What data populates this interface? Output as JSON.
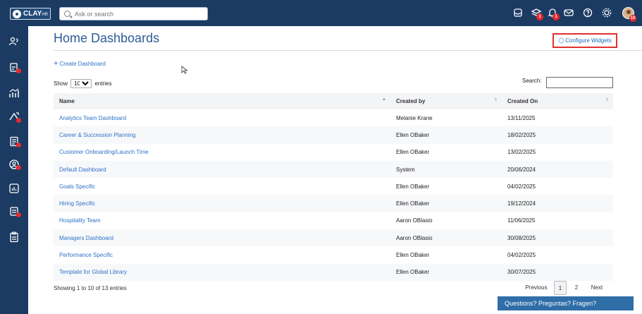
{
  "brand": {
    "logo_main": "CLAY",
    "logo_sub": "HR"
  },
  "topbar": {
    "search_placeholder": "Ask or search",
    "badges": [
      "1",
      "1",
      "10"
    ]
  },
  "page": {
    "title": "Home Dashboards",
    "configure_label": "Configure Widgets",
    "create_label": "Create Dashboard",
    "show_label": "Show",
    "entries_label": "entries",
    "entries_value": "10",
    "search_label": "Search:"
  },
  "table": {
    "headers": [
      "Name",
      "Created by",
      "Created On"
    ],
    "rows": [
      [
        "Analytics Team Dashboard",
        "Melanie Krane",
        "13/11/2025"
      ],
      [
        "Career & Succession Planning",
        "Ellen OBaker",
        "18/02/2025"
      ],
      [
        "Customer Onboarding/Launch Time",
        "Ellen OBaker",
        "13/02/2025"
      ],
      [
        "Default Dashboard",
        "System",
        "20/06/2024"
      ],
      [
        "Goals Specific",
        "Ellen OBaker",
        "04/02/2025"
      ],
      [
        "Hiring Specific",
        "Ellen OBaker",
        "19/12/2024"
      ],
      [
        "Hospitality Team",
        "Aaron OBlasio",
        "11/06/2025"
      ],
      [
        "Managers Dashboard",
        "Aaron OBlasio",
        "30/08/2025"
      ],
      [
        "Performance Specific",
        "Ellen OBaker",
        "04/02/2025"
      ],
      [
        "Template for Global Library",
        "Ellen OBaker",
        "30/07/2025"
      ]
    ]
  },
  "footer": {
    "info": "Showing 1 to 10 of 13 entries",
    "previous": "Previous",
    "page1": "1",
    "page2": "2",
    "next": "Next"
  },
  "help": {
    "label": "Questions? Preguntas? Fragen?"
  },
  "colors": {
    "navy": "#1b3b63",
    "link": "#2c73c7",
    "badge": "#e9272d"
  },
  "icons": [
    "search-icon",
    "inbox-icon",
    "layers-icon",
    "bell-icon",
    "mail-icon",
    "help-icon",
    "settings-icon",
    "users-icon",
    "report-icon",
    "analytics-icon",
    "goals-icon",
    "document-icon",
    "person-icon",
    "chart-icon",
    "tasks-icon",
    "clipboard-icon",
    "configure-icon"
  ]
}
